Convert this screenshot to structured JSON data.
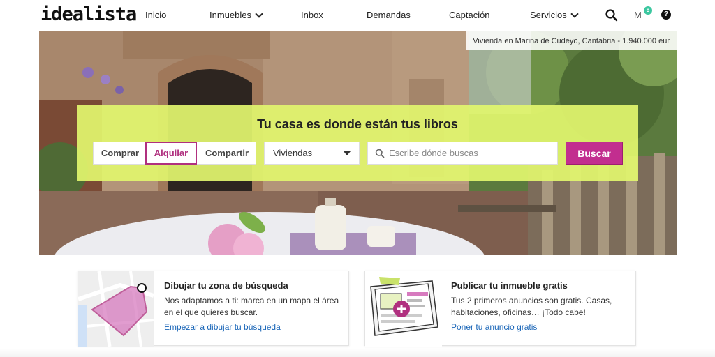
{
  "header": {
    "logo": "idealista",
    "nav": [
      {
        "label": "Inicio"
      },
      {
        "label": "Inmuebles"
      },
      {
        "label": "Inbox"
      },
      {
        "label": "Demandas"
      },
      {
        "label": "Captación"
      },
      {
        "label": "Servicios"
      }
    ],
    "user_initial": "M",
    "notification_count": "8",
    "help_label": "?",
    "icons": [
      "search-icon",
      "help-icon",
      "chevron-down-icon"
    ]
  },
  "hero": {
    "caption": "Vivienda en Marina de Cudeyo, Cantabria - 1.940.000 eur",
    "title": "Tu casa es donde están tus libros",
    "operations": [
      "Comprar",
      "Alquilar",
      "Compartir"
    ],
    "active_operation": "Alquilar",
    "property_type": "Viviendas",
    "location_placeholder": "Escribe dónde buscas",
    "search_button": "Buscar"
  },
  "cards": [
    {
      "title": "Dibujar tu zona de búsqueda",
      "description": "Nos adaptamos a ti: marca en un mapa el área en el que quieres buscar.",
      "link": "Empezar a dibujar tu búsqueda"
    },
    {
      "title": "Publicar tu inmueble gratis",
      "description": "Tus 2 primeros anuncios son gratis. Casas, habitaciones, oficinas… ¡Todo cabe!",
      "link": "Poner tu anuncio gratis"
    }
  ],
  "colors": {
    "brand": "#c22e8f",
    "panel": "#e1f56e",
    "link": "#1a66b8",
    "badge": "#3cc7a0"
  }
}
